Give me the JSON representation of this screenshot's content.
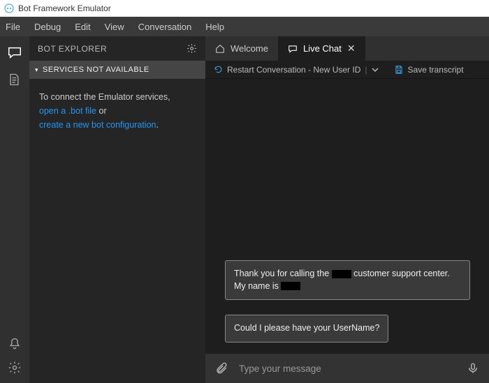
{
  "titlebar": {
    "title": "Bot Framework Emulator"
  },
  "menu": {
    "file": "File",
    "debug": "Debug",
    "edit": "Edit",
    "view": "View",
    "conversation": "Conversation",
    "help": "Help"
  },
  "sidebar": {
    "title": "BOT EXPLORER",
    "section": "SERVICES NOT AVAILABLE",
    "msg_pre": "To connect the Emulator services,",
    "link_open": "open a .bot file",
    "msg_or": " or ",
    "link_create": "create a new bot configuration",
    "msg_dot": "."
  },
  "tabs": {
    "welcome": "Welcome",
    "livechat": "Live Chat"
  },
  "toolbar": {
    "restart": "Restart Conversation - New User ID",
    "save": "Save transcript"
  },
  "chat": {
    "msg1_a": "Thank you for calling the ",
    "msg1_b": " customer support center. My name is ",
    "msg2": "Could I please have your UserName?"
  },
  "composer": {
    "placeholder": "Type your message"
  }
}
